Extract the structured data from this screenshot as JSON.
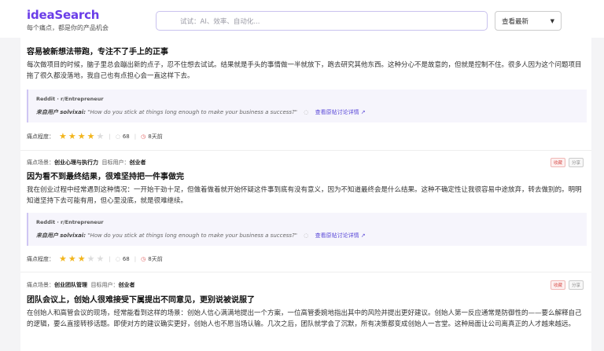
{
  "header": {
    "brand": "ideaSearch",
    "tagline": "每个痛点，都是你的产品机会",
    "search_placeholder": "试试：AI、效率、自动化...",
    "sort_label": "查看最新",
    "sort_caret": "▼"
  },
  "common": {
    "meta_scene_prefix": "痛点场景：",
    "meta_user_prefix": "目标用户：",
    "pain_label": "痛点程度：",
    "badge_a": "收藏",
    "badge_b": "分享",
    "source_prefix": "来自用户",
    "link_text": "查看原帖讨论详情 ↗",
    "comment_icon": "comment-icon",
    "time_icon": "clock-icon"
  },
  "cards": [
    {
      "title": "容易被新想法带跑，专注不了手上的正事",
      "desc": "每次做项目的时候，脑子里总会蹦出新的点子，忍不住想去试试。结果就是手头的事情做一半就放下，跑去研究其他东西。这种分心不是故意的，但就是控制不住。很多人因为这个问题项目拖了很久都没落地，我自己也有点担心会一直这样下去。",
      "source": "Reddit · r/Entrepreneur",
      "user": "solvixai",
      "quote": "\"How do you stick at things long enough to make your business a success?\"",
      "rating": 4,
      "comments": "68",
      "time": "8天前"
    },
    {
      "scene": "创业心理与执行力",
      "target": "创业者",
      "title": "因为看不到最终结果，很难坚持把一件事做完",
      "desc": "我在创业过程中经常遇到这种情况：一开始干劲十足，但做着做着就开始怀疑这件事到底有没有意义，因为不知道最终会是什么结果。这种不确定性让我很容易中途放弃，转去做别的。明明知道坚持下去可能有用，但心里没底，就是很难继续。",
      "source": "Reddit · r/Entrepreneur",
      "user": "solvixai",
      "quote": "\"How do you stick at things long enough to make your business a success?\"",
      "rating": 3,
      "comments": "68",
      "time": "8天前"
    },
    {
      "scene": "创业团队管理",
      "target": "创业者",
      "title": "团队会议上，创始人很难接受下属提出不同意见，更别说被说服了",
      "desc": "在创始人和高管会议的现场，经常能看到这样的场景：创始人信心满满地提出一个方案，一位高管委婉地指出其中的风险并提出更好建议。创始人第一反应通常是防御性的——要么解释自己的逻辑，要么直接转移话题。即使对方的建议确实更好，创始人也不愿当场认输。几次之后，团队就学会了沉默，所有决策都变成创始人一言堂。这种局面让公司离真正的人才越来越远。"
    }
  ]
}
